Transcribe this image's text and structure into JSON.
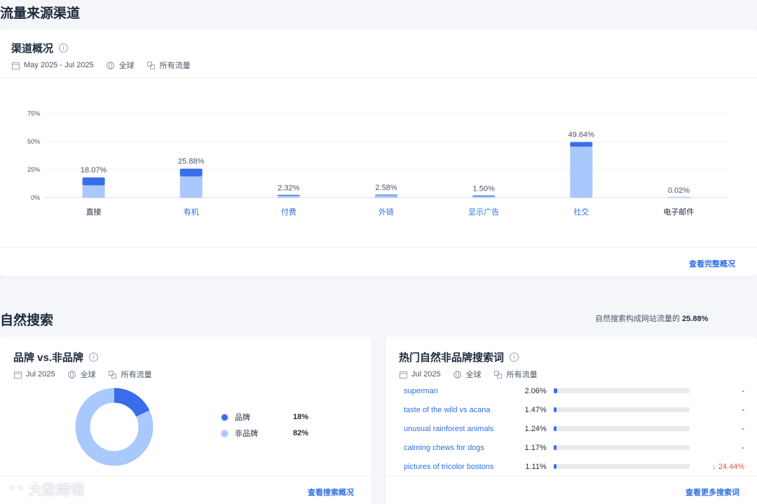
{
  "page_title": "流量来源渠道",
  "overview": {
    "title": "渠道概况",
    "date_range": "May 2025 - Jul 2025",
    "region": "全球",
    "traffic": "所有流量",
    "link": "查看完整概况"
  },
  "chart_data": {
    "type": "bar",
    "stacked": true,
    "categories": [
      "直接",
      "有机",
      "付费",
      "外链",
      "显示广告",
      "社交",
      "电子邮件"
    ],
    "totals": [
      18.07,
      25.88,
      2.32,
      2.58,
      1.5,
      49.64,
      0.02
    ],
    "total_labels": [
      "18.07%",
      "25.88%",
      "2.32%",
      "2.58%",
      "1.50%",
      "49.64%",
      "0.02%"
    ],
    "series": [
      {
        "values": [
          11.0,
          19.0,
          1.8,
          2.0,
          1.2,
          45.5,
          0.02
        ],
        "color": "#a9c8fb"
      },
      {
        "values": [
          7.07,
          6.88,
          0.52,
          0.58,
          0.3,
          4.14,
          0.0
        ],
        "color": "#3a6ee8"
      }
    ],
    "yticks": [
      "0%",
      "25%",
      "50%",
      "75%"
    ],
    "ytick_values": [
      0,
      25,
      50,
      75
    ],
    "ylim": [
      0,
      75
    ],
    "category_colors": [
      "#1f2a3c",
      "#2f6fe8",
      "#2f6fe8",
      "#2f6fe8",
      "#2f6fe8",
      "#2f6fe8",
      "#1f2a3c"
    ],
    "grid": true
  },
  "organic": {
    "section_title": "自然搜索",
    "share_text": "自然搜索构成网站流量的",
    "share_value": "25.88%"
  },
  "brand": {
    "title": "品牌 vs.非品牌",
    "date": "Jul 2025",
    "region": "全球",
    "traffic": "所有流量",
    "legend": [
      {
        "label": "品牌",
        "value": "18%",
        "pct": 18,
        "color": "#3a6ee8"
      },
      {
        "label": "非品牌",
        "value": "82%",
        "pct": 82,
        "color": "#a9c8fb"
      }
    ],
    "link": "查看搜索概况"
  },
  "keywords": {
    "title": "热门自然非品牌搜索词",
    "date": "Jul 2025",
    "region": "全球",
    "traffic": "所有流量",
    "rows": [
      {
        "term": "superman",
        "share": "2.06%",
        "pct": 2.06,
        "change": "-",
        "down": false
      },
      {
        "term": "taste of the wild vs acana",
        "share": "1.47%",
        "pct": 1.47,
        "change": "-",
        "down": false
      },
      {
        "term": "unusual rainforest animals",
        "share": "1.24%",
        "pct": 1.24,
        "change": "-",
        "down": false
      },
      {
        "term": "calming chews for dogs",
        "share": "1.17%",
        "pct": 1.17,
        "change": "-",
        "down": false
      },
      {
        "term": "pictures of tricolor bostons",
        "share": "1.11%",
        "pct": 1.11,
        "change": "24.44%",
        "down": true
      }
    ],
    "link": "查看更多搜索词"
  },
  "watermark": "大数跨境",
  "icons": [
    "info-icon",
    "calendar-icon",
    "globe-icon",
    "traffic-icon",
    "arrow-down-icon",
    "logo-icon"
  ]
}
